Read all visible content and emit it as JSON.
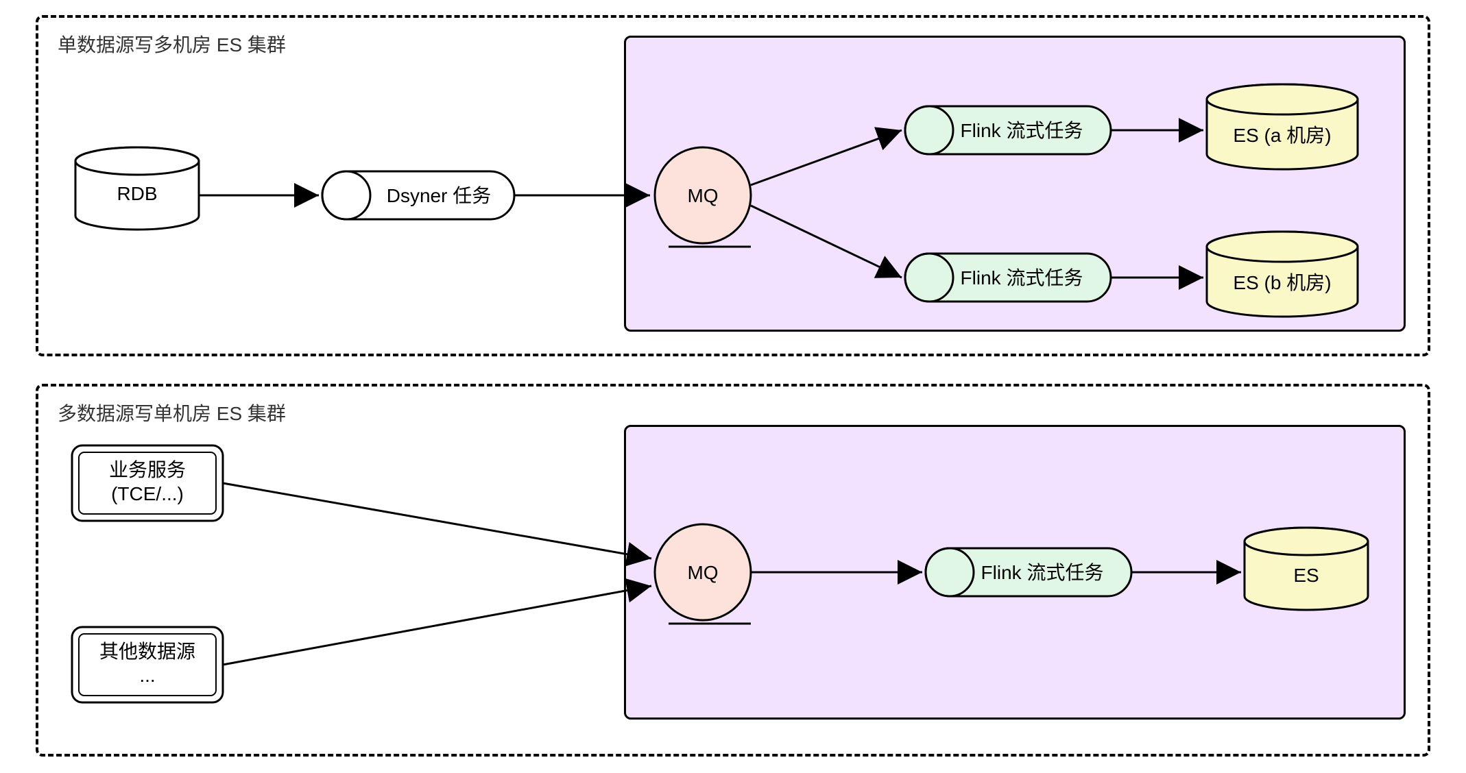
{
  "panel1": {
    "title": "单数据源写多机房 ES 集群",
    "rdb": "RDB",
    "dsyner": "Dsyner 任务",
    "mq": "MQ",
    "flink1": "Flink 流式任务",
    "flink2": "Flink 流式任务",
    "es_a": "ES (a 机房)",
    "es_b": "ES (b 机房)"
  },
  "panel2": {
    "title": "多数据源写单机房 ES 集群",
    "biz_line1": "业务服务",
    "biz_line2": "(TCE/...)",
    "other_line1": "其他数据源",
    "other_line2": "...",
    "mq": "MQ",
    "flink": "Flink 流式任务",
    "es": "ES"
  },
  "colors": {
    "pink": "#fde2dc",
    "mint": "#e0f7e6",
    "yellow": "#fbf8c8",
    "purple": "#f2e2ff"
  }
}
